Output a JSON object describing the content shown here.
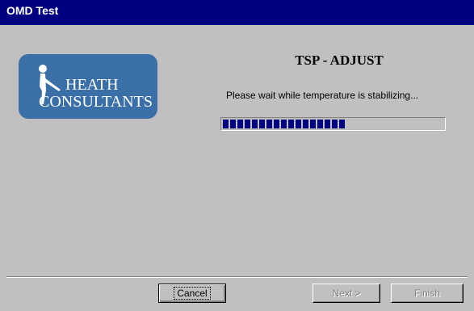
{
  "window": {
    "title": "OMD Test"
  },
  "logo": {
    "line1": "HEATH",
    "line2": "CONSULTANTS",
    "brand_color": "#3a6fa8"
  },
  "main": {
    "heading": "TSP - ADJUST",
    "message": "Please wait while temperature is stabilizing...",
    "progress": 0.56
  },
  "buttons": {
    "cancel": "Cancel",
    "next": "Next >",
    "finish": "Finish"
  },
  "colors": {
    "titlebar": "#000080",
    "progress_fill": "#000080",
    "face": "#c0c0c0"
  }
}
